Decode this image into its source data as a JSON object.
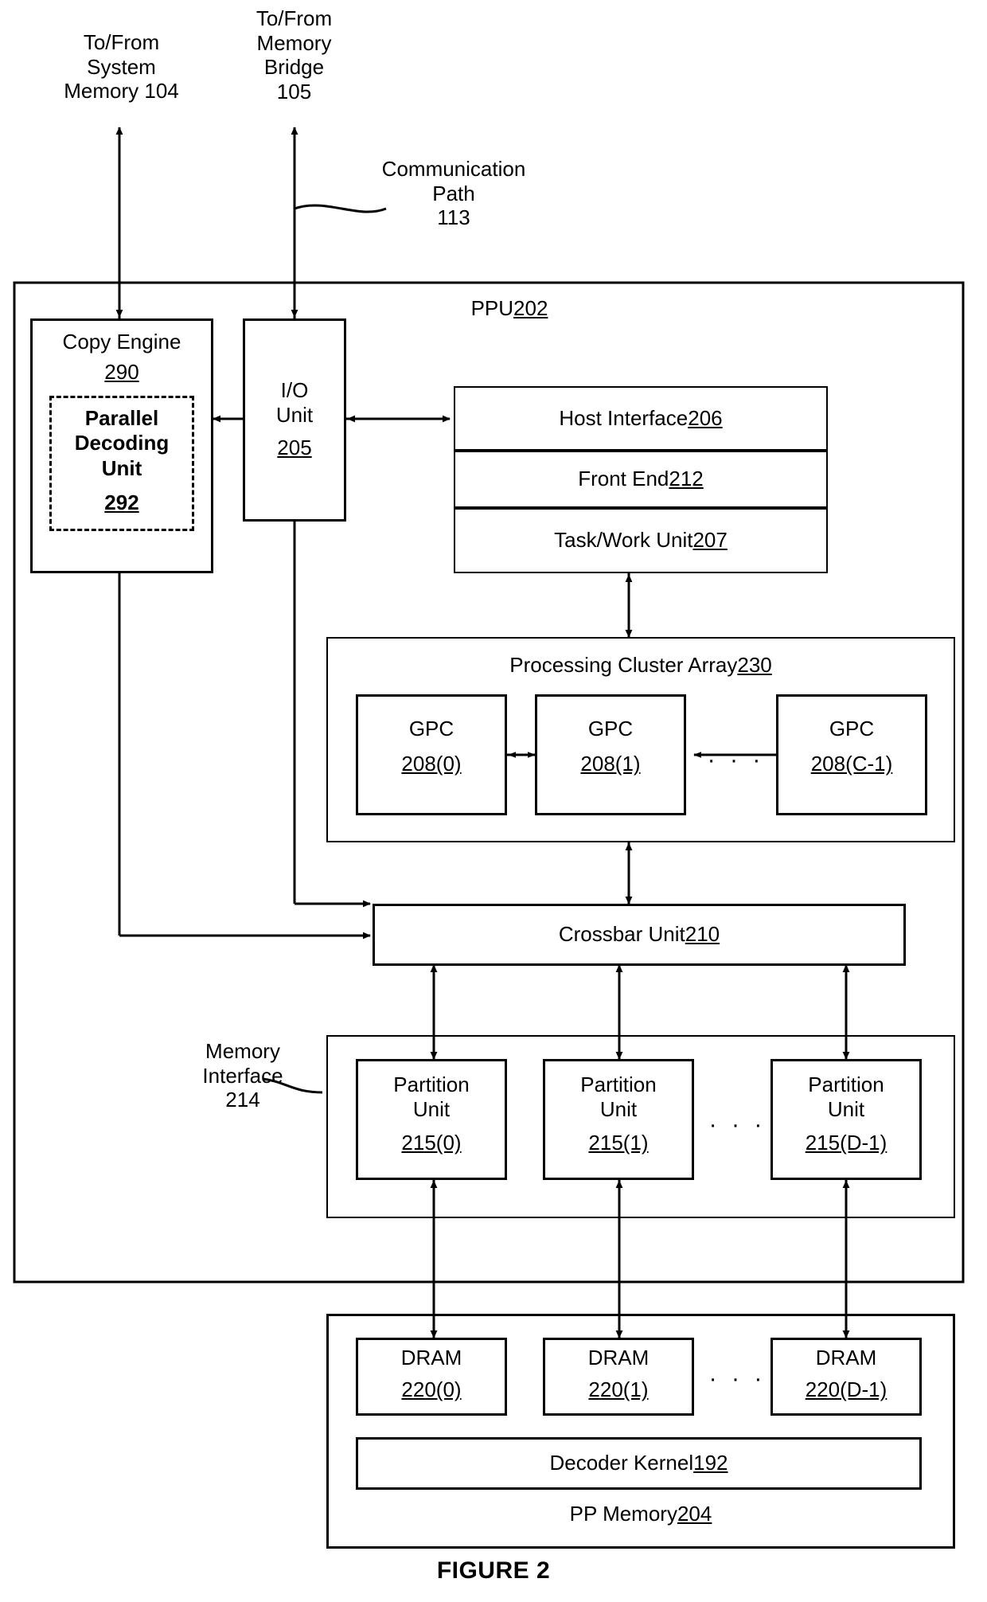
{
  "figure": {
    "caption": "FIGURE 2"
  },
  "external_labels": {
    "system_memory": "To/From\nSystem\nMemory 104",
    "memory_bridge": "To/From\nMemory\nBridge\n105",
    "communication_path": "Communication\nPath\n113",
    "memory_interface": "Memory\nInterface\n214"
  },
  "ppu": {
    "title": "PPU ",
    "title_ref": "202",
    "copy_engine": {
      "label": "Copy Engine",
      "ref": "290"
    },
    "parallel_decoding_unit": {
      "label": "Parallel\nDecoding\nUnit",
      "ref": "292"
    },
    "io_unit": {
      "label": "I/O\nUnit",
      "ref": "205"
    },
    "host_interface": {
      "label": "Host Interface ",
      "ref": "206"
    },
    "front_end": {
      "label": "Front End ",
      "ref": "212"
    },
    "task_work_unit": {
      "label": "Task/Work Unit ",
      "ref": "207"
    },
    "processing_cluster_array": {
      "label": "Processing Cluster Array ",
      "ref": "230",
      "gpcs": [
        {
          "label": "GPC",
          "ref": "208(0)"
        },
        {
          "label": "GPC",
          "ref": "208(1)"
        },
        {
          "label": "GPC",
          "ref": "208(C-1)"
        }
      ],
      "ellipsis": "· · ·"
    },
    "crossbar_unit": {
      "label": "Crossbar Unit ",
      "ref": "210"
    },
    "memory_interface_group": {
      "partition_units": [
        {
          "label": "Partition\nUnit",
          "ref": "215(0)"
        },
        {
          "label": "Partition\nUnit",
          "ref": "215(1)"
        },
        {
          "label": "Partition\nUnit",
          "ref": "215(D-1)"
        }
      ],
      "ellipsis": "· · ·"
    }
  },
  "pp_memory": {
    "label": "PP Memory ",
    "ref": "204",
    "drams": [
      {
        "label": "DRAM",
        "ref": "220(0)"
      },
      {
        "label": "DRAM",
        "ref": "220(1)"
      },
      {
        "label": "DRAM",
        "ref": "220(D-1)"
      }
    ],
    "ellipsis": "· · ·",
    "decoder_kernel": {
      "label": "Decoder Kernel ",
      "ref": "192"
    }
  },
  "colors": {
    "stroke": "#000000",
    "background": "#ffffff"
  }
}
